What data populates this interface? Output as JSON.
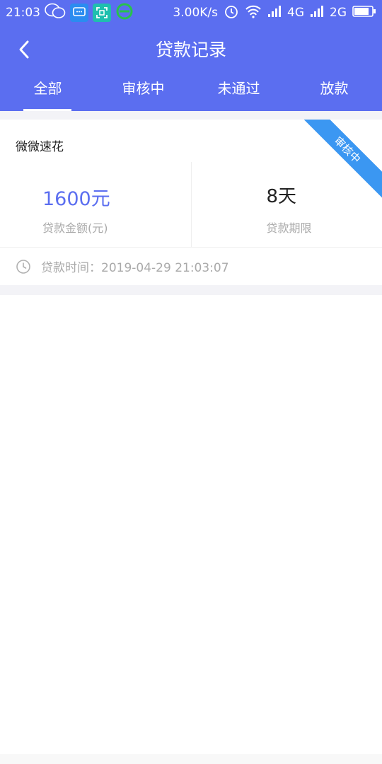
{
  "status_bar": {
    "time": "21:03",
    "speed": "3.00K/s",
    "net1": "4G",
    "net2": "2G"
  },
  "header": {
    "title": "贷款记录",
    "tabs": [
      {
        "label": "全部",
        "active": true
      },
      {
        "label": "审核中",
        "active": false
      },
      {
        "label": "未通过",
        "active": false
      },
      {
        "label": "放款",
        "active": false
      }
    ]
  },
  "card": {
    "name": "微微速花",
    "amount": "1600元",
    "amount_label": "贷款金额(元)",
    "term": "8天",
    "term_label": "贷款期限",
    "status": "审核中",
    "time_label": "贷款时间：",
    "time": "2019-04-29 21:03:07"
  },
  "colors": {
    "primary": "#5b6ef0",
    "ribbon": "#3b97f2"
  }
}
